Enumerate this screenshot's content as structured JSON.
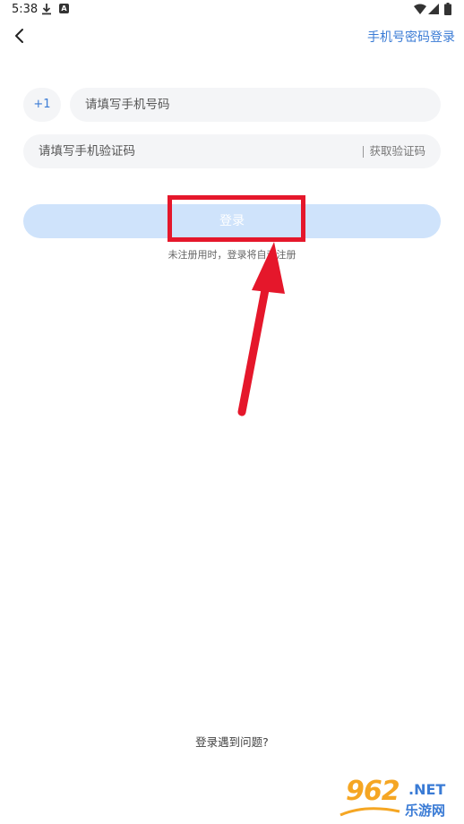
{
  "status_bar": {
    "time": "5:38",
    "icons": [
      "download-icon",
      "a-icon",
      "wifi-icon",
      "cellular-icon",
      "battery-icon"
    ]
  },
  "header": {
    "back_icon": "chevron-left-icon",
    "link_label": "手机号密码登录"
  },
  "form": {
    "country_code": "+1",
    "phone_placeholder": "请填写手机号码",
    "phone_value": "",
    "code_placeholder": "请填写手机验证码",
    "code_value": "",
    "get_code_label": "获取验证码",
    "login_label": "登录",
    "register_note": "未注册用时，登录将自动注册"
  },
  "footer": {
    "help_label": "登录遇到问题?"
  },
  "watermark": {
    "brand_num": "962",
    "brand_tld": ".NET",
    "brand_sub": "乐游网"
  },
  "colors": {
    "accent": "#3a7bd5",
    "button_disabled": "#cfe3fb",
    "field_bg": "#f4f5f7",
    "highlight": "#e5172b"
  }
}
